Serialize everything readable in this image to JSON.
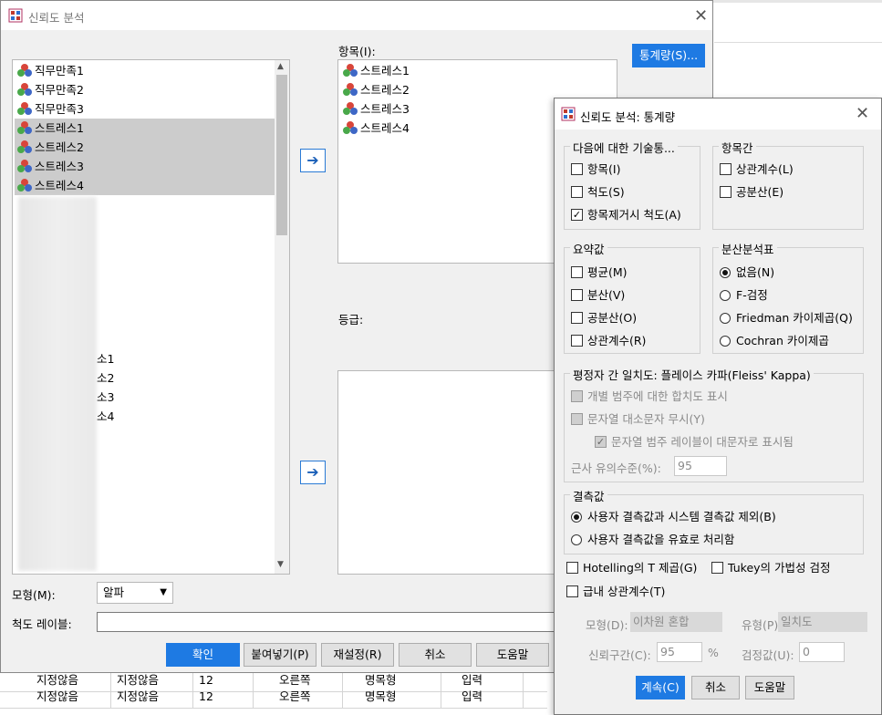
{
  "main_dialog": {
    "title": "신뢰도 분석",
    "source_vars": [
      {
        "label": "직무만족1",
        "selected": false
      },
      {
        "label": "직무만족2",
        "selected": false
      },
      {
        "label": "직무만족3",
        "selected": false
      },
      {
        "label": "스트레스1",
        "selected": true
      },
      {
        "label": "스트레스2",
        "selected": true
      },
      {
        "label": "스트레스3",
        "selected": true
      },
      {
        "label": "스트레스4",
        "selected": true
      }
    ],
    "partial_vars": [
      "소1",
      "소2",
      "소3",
      "소4"
    ],
    "items_label": "항목(I):",
    "items": [
      "스트레스1",
      "스트레스2",
      "스트레스3",
      "스트레스4"
    ],
    "ratings_label": "등급:",
    "statistics_button": "통계량(S)...",
    "model_label": "모형(M):",
    "model_value": "알파",
    "scale_label": "척도 레이블:",
    "buttons": {
      "ok": "확인",
      "paste": "붙여넣기(P)",
      "reset": "재설정(R)",
      "cancel": "취소",
      "help": "도움말"
    }
  },
  "background_table": [
    [
      "지정않음",
      "지정않음",
      "12",
      "오른쪽",
      "명목형",
      "입력"
    ],
    [
      "지정않음",
      "지정않음",
      "12",
      "오른쪽",
      "명목형",
      "입력"
    ]
  ],
  "stats_dialog": {
    "title": "신뢰도 분석: 통계량",
    "descriptives": {
      "label": "다음에 대한 기술통...",
      "items": [
        {
          "label": "항목(I)",
          "checked": false
        },
        {
          "label": "척도(S)",
          "checked": false
        },
        {
          "label": "항목제거시 척도(A)",
          "checked": true
        }
      ]
    },
    "inter_item": {
      "label": "항목간",
      "items": [
        {
          "label": "상관계수(L)",
          "checked": false
        },
        {
          "label": "공분산(E)",
          "checked": false
        }
      ]
    },
    "summaries": {
      "label": "요약값",
      "items": [
        {
          "label": "평균(M)",
          "checked": false
        },
        {
          "label": "분산(V)",
          "checked": false
        },
        {
          "label": "공분산(O)",
          "checked": false
        },
        {
          "label": "상관계수(R)",
          "checked": false
        }
      ]
    },
    "anova": {
      "label": "분산분석표",
      "items": [
        {
          "label": "없음(N)",
          "selected": true
        },
        {
          "label": "F-검정",
          "selected": false
        },
        {
          "label": "Friedman 카이제곱(Q)",
          "selected": false
        },
        {
          "label": "Cochran 카이제곱",
          "selected": false
        }
      ]
    },
    "fleiss": {
      "label": "평정자 간 일치도: 플레이스 카파(Fleiss' Kappa)",
      "items": [
        "개별 범주에 대한 합치도 표시",
        "문자열 대소문자 무시(Y)",
        "문자열 범주 레이블이 대문자로 표시됨"
      ],
      "alpha_label": "근사 유의수준(%):",
      "alpha_value": "95"
    },
    "missing": {
      "label": "결측값",
      "items": [
        {
          "label": "사용자 결측값과 시스템 결측값 제외(B)",
          "selected": true
        },
        {
          "label": "사용자 결측값을 유효로 처리함",
          "selected": false
        }
      ]
    },
    "hotelling": "Hotelling의 T 제곱(G)",
    "tukey": "Tukey의 가법성 검정",
    "icc": "급내 상관계수(T)",
    "icc_model_label": "모형(D):",
    "icc_model_value": "이차원 혼합",
    "icc_type_label": "유형(P):",
    "icc_type_value": "일치도",
    "ci_label": "신뢰구간(C):",
    "ci_value": "95",
    "ci_unit": "%",
    "test_label": "검정값(U):",
    "test_value": "0",
    "buttons": {
      "continue": "계속(C)",
      "cancel": "취소",
      "help": "도움말"
    }
  }
}
